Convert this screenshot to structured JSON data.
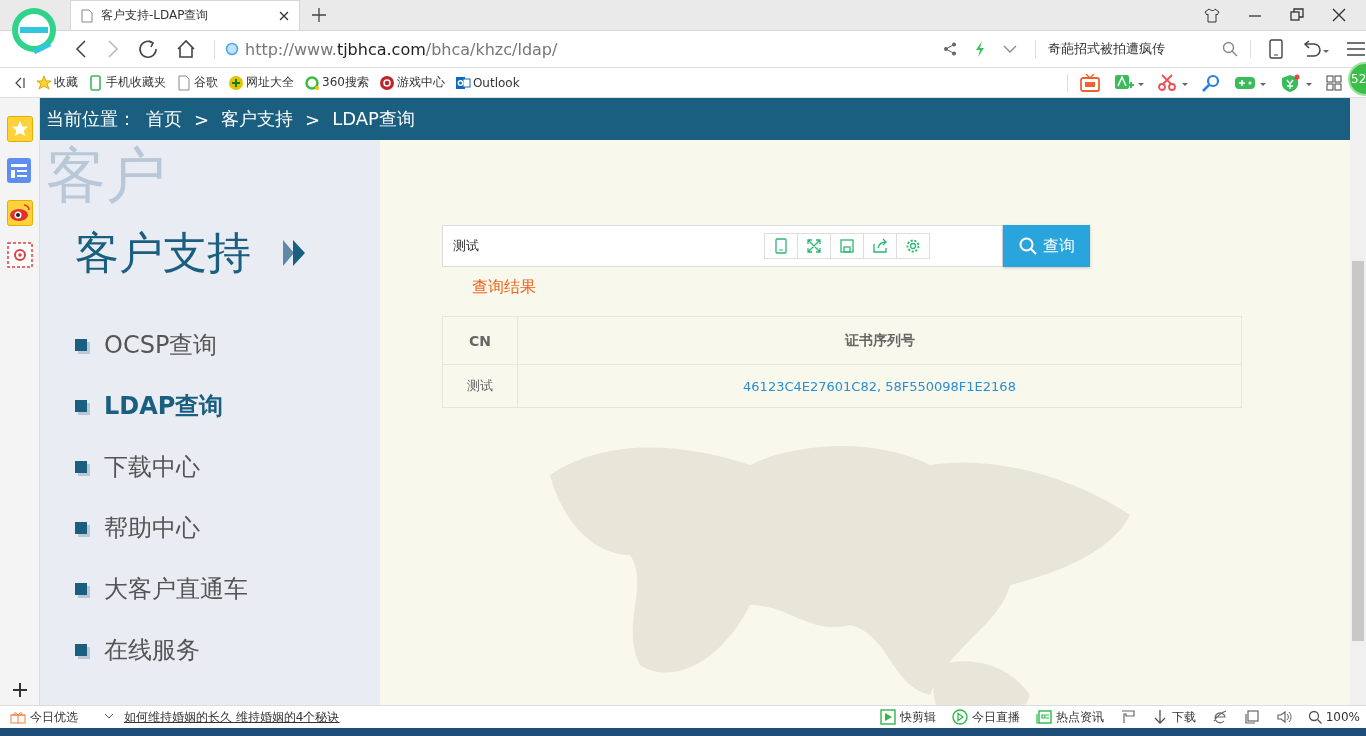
{
  "browser": {
    "tab_title": "客户支持-LDAP查询",
    "url_scheme": "http://www.",
    "url_domain": "tjbhca.com",
    "url_path": "/bhca/khzc/ldap/",
    "search_text": "奇葩招式被拍遭疯传",
    "badge": "52"
  },
  "bookmarks": [
    {
      "label": "收藏",
      "kind": "star"
    },
    {
      "label": "手机收藏夹",
      "kind": "phone"
    },
    {
      "label": "谷歌",
      "kind": "page"
    },
    {
      "label": "网址大全",
      "kind": "plus"
    },
    {
      "label": "360搜索",
      "kind": "ring"
    },
    {
      "label": "游戏中心",
      "kind": "game"
    },
    {
      "label": "Outlook",
      "kind": "outlook"
    }
  ],
  "breadcrumb": {
    "label": "当前位置：",
    "items": [
      "首页",
      "客户支持",
      "LDAP查询"
    ],
    "separator": ">"
  },
  "sidebar": {
    "watermark": "客户",
    "title": "客户支持",
    "items": [
      {
        "label": "OCSP查询",
        "selected": false
      },
      {
        "label": "LDAP查询",
        "selected": true
      },
      {
        "label": "下载中心",
        "selected": false
      },
      {
        "label": "帮助中心",
        "selected": false
      },
      {
        "label": "大客户直通车",
        "selected": false
      },
      {
        "label": "在线服务",
        "selected": false
      }
    ]
  },
  "search": {
    "value": "测试",
    "button": "查询"
  },
  "result_label": "查询结果",
  "table": {
    "columns": [
      "CN",
      "证书序列号"
    ],
    "rows": [
      [
        "测试",
        "46123C4E27601C82, 58F550098F1E2168"
      ]
    ]
  },
  "status_bar": {
    "left": "今日优选",
    "news": "如何维持婚姻的长久 维持婚姻的4个秘诀",
    "items": [
      {
        "label": "快剪辑",
        "kind": "play-square"
      },
      {
        "label": "今日直播",
        "kind": "play-circle"
      },
      {
        "label": "热点资讯",
        "kind": "news"
      },
      {
        "label": "下载",
        "kind": "download"
      }
    ],
    "zoom": "100%"
  }
}
